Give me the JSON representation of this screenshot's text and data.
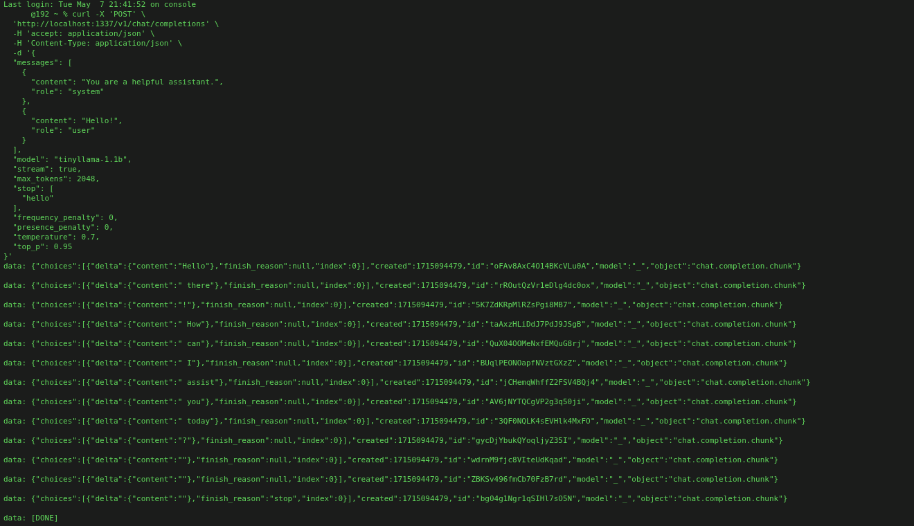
{
  "terminal": {
    "command_lines": [
      "Last login: Tue May  7 21:41:52 on console",
      "      @192 ~ % curl -X 'POST' \\",
      "  'http://localhost:1337/v1/chat/completions' \\",
      "  -H 'accept: application/json' \\",
      "  -H 'Content-Type: application/json' \\",
      "  -d '{",
      "  \"messages\": [",
      "    {",
      "      \"content\": \"You are a helpful assistant.\",",
      "      \"role\": \"system\"",
      "    },",
      "    {",
      "      \"content\": \"Hello!\",",
      "      \"role\": \"user\"",
      "    }",
      "  ],",
      "  \"model\": \"tinyllama-1.1b\",",
      "  \"stream\": true,",
      "  \"max_tokens\": 2048,",
      "  \"stop\": [",
      "    \"hello\"",
      "  ],",
      "  \"frequency_penalty\": 0,",
      "  \"presence_penalty\": 0,",
      "  \"temperature\": 0.7,",
      "  \"top_p\": 0.95",
      "}'"
    ],
    "stream_lines": [
      "data: {\"choices\":[{\"delta\":{\"content\":\"Hello\"},\"finish_reason\":null,\"index\":0}],\"created\":1715094479,\"id\":\"oFAv8AxC4O14BKcVLu0A\",\"model\":\"_\",\"object\":\"chat.completion.chunk\"}",
      "data: {\"choices\":[{\"delta\":{\"content\":\" there\"},\"finish_reason\":null,\"index\":0}],\"created\":1715094479,\"id\":\"rROutQzVr1eDlg4dc0ox\",\"model\":\"_\",\"object\":\"chat.completion.chunk\"}",
      "data: {\"choices\":[{\"delta\":{\"content\":\"!\"},\"finish_reason\":null,\"index\":0}],\"created\":1715094479,\"id\":\"5K7ZdKRpMlRZsPgi8MB7\",\"model\":\"_\",\"object\":\"chat.completion.chunk\"}",
      "data: {\"choices\":[{\"delta\":{\"content\":\" How\"},\"finish_reason\":null,\"index\":0}],\"created\":1715094479,\"id\":\"taAxzHLiDdJ7PdJ9JSgB\",\"model\":\"_\",\"object\":\"chat.completion.chunk\"}",
      "data: {\"choices\":[{\"delta\":{\"content\":\" can\"},\"finish_reason\":null,\"index\":0}],\"created\":1715094479,\"id\":\"QuX04OOMeNxfEMQuG8rj\",\"model\":\"_\",\"object\":\"chat.completion.chunk\"}",
      "data: {\"choices\":[{\"delta\":{\"content\":\" I\"},\"finish_reason\":null,\"index\":0}],\"created\":1715094479,\"id\":\"BUqlPEONOapfNVztGXzZ\",\"model\":\"_\",\"object\":\"chat.completion.chunk\"}",
      "data: {\"choices\":[{\"delta\":{\"content\":\" assist\"},\"finish_reason\":null,\"index\":0}],\"created\":1715094479,\"id\":\"jCHemqWhffZ2FSV4BQj4\",\"model\":\"_\",\"object\":\"chat.completion.chunk\"}",
      "data: {\"choices\":[{\"delta\":{\"content\":\" you\"},\"finish_reason\":null,\"index\":0}],\"created\":1715094479,\"id\":\"AV6jNYTQCgVP2g3q50ji\",\"model\":\"_\",\"object\":\"chat.completion.chunk\"}",
      "data: {\"choices\":[{\"delta\":{\"content\":\" today\"},\"finish_reason\":null,\"index\":0}],\"created\":1715094479,\"id\":\"3QF0NQLK4sEVHlk4MxFO\",\"model\":\"_\",\"object\":\"chat.completion.chunk\"}",
      "data: {\"choices\":[{\"delta\":{\"content\":\"?\"},\"finish_reason\":null,\"index\":0}],\"created\":1715094479,\"id\":\"gycDjYbukQYoqljyZ35I\",\"model\":\"_\",\"object\":\"chat.completion.chunk\"}",
      "data: {\"choices\":[{\"delta\":{\"content\":\"\"},\"finish_reason\":null,\"index\":0}],\"created\":1715094479,\"id\":\"wdrnM9fjc8VIteUdKqad\",\"model\":\"_\",\"object\":\"chat.completion.chunk\"}",
      "data: {\"choices\":[{\"delta\":{\"content\":\"\"},\"finish_reason\":null,\"index\":0}],\"created\":1715094479,\"id\":\"ZBKSv496fmCb70FzB7rd\",\"model\":\"_\",\"object\":\"chat.completion.chunk\"}",
      "data: {\"choices\":[{\"delta\":{\"content\":\"\"},\"finish_reason\":\"stop\",\"index\":0}],\"created\":1715094479,\"id\":\"bg04g1Ngr1qSIHl7sO5N\",\"model\":\"_\",\"object\":\"chat.completion.chunk\"}",
      "data: [DONE]"
    ]
  }
}
